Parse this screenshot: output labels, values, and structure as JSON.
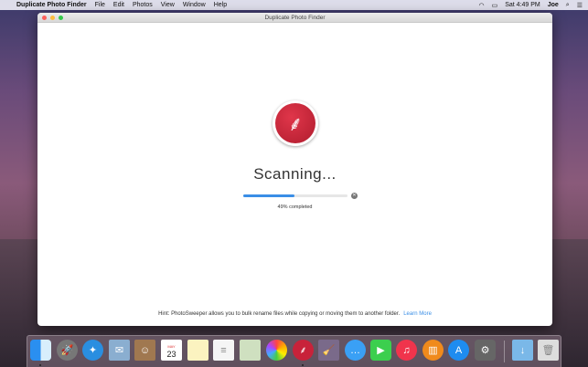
{
  "menubar": {
    "app": "Duplicate Photo Finder",
    "items": [
      "File",
      "Edit",
      "Photos",
      "View",
      "Window",
      "Help"
    ],
    "clock": "Sat 4:49 PM",
    "user": "Joe"
  },
  "window": {
    "title": "Duplicate Photo Finder"
  },
  "main": {
    "status": "Scanning...",
    "progress_percent": 49,
    "progress_label": "49% completed",
    "hint": "Hint: PhotoSweeper allows you to bulk rename files while copying or moving them to another folder.",
    "learn_more": "Learn More"
  },
  "dock": {
    "calendar_month": "MAY",
    "calendar_day": "23",
    "items": [
      "finder",
      "launchpad",
      "safari",
      "mail",
      "contacts",
      "calendar",
      "notes",
      "reminders",
      "preview",
      "photos",
      "duplicate-photo-finder",
      "photosweeper",
      "messages",
      "facetime",
      "itunes",
      "ibooks",
      "app-store",
      "system-preferences",
      "downloads",
      "trash"
    ]
  },
  "colors": {
    "accent": "#3a8ee6",
    "brand": "#c8223a"
  }
}
